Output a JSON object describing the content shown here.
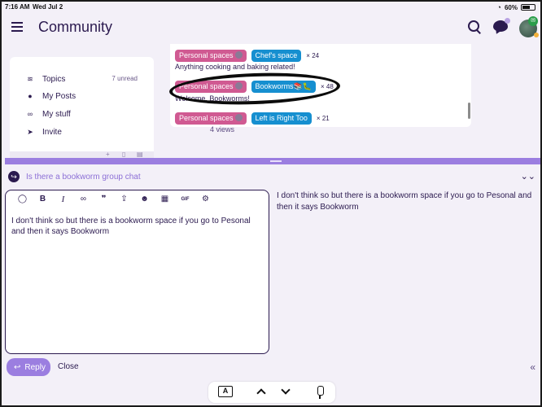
{
  "status_bar": {
    "time": "7:16 AM",
    "date": "Wed Jul 2",
    "battery": "60%"
  },
  "header": {
    "title": "Community"
  },
  "sidebar": {
    "items": [
      {
        "label": "Topics",
        "icon": "layers-icon",
        "count": "7 unread"
      },
      {
        "label": "My Posts",
        "icon": "user-icon"
      },
      {
        "label": "My stuff",
        "icon": "link-icon"
      },
      {
        "label": "Invite",
        "icon": "send-icon"
      }
    ]
  },
  "topic_list": {
    "rows": [
      {
        "parent": "Personal spaces",
        "tag": "Chef's space",
        "count": "× 24",
        "desc": "Anything cooking and baking related!"
      },
      {
        "parent": "Personal spaces",
        "tag": "Bookworms📚🐛",
        "count": "× 48",
        "desc": "Welcome, Bookworms!"
      },
      {
        "parent": "Personal spaces",
        "tag": "Left is Right Too",
        "count": "× 21"
      }
    ],
    "views": "4 views"
  },
  "composer": {
    "reply_to": "Is there a bookworm group chat",
    "editor_text": "I don't think so but there is a bookworm space if you go to Pesonal and then it says Bookworm",
    "preview_text": "I don't think so but there is a bookworm space if you go to Pesonal and then it says Bookworm",
    "toolbar": [
      "quote-icon",
      "bold-icon",
      "italic-icon",
      "link-icon",
      "blockquote-icon",
      "upload-icon",
      "emoji-icon",
      "calendar-icon",
      "gif-icon",
      "gear-icon"
    ],
    "gif_label": "GIF",
    "reply_label": "Reply",
    "close_label": "Close"
  },
  "keyboard_bar": {
    "format_label": "A"
  },
  "colors": {
    "accent": "#9b7ee0",
    "text": "#2b1a4f",
    "tag_pink": "#d05a92",
    "tag_blue": "#168fd0"
  }
}
